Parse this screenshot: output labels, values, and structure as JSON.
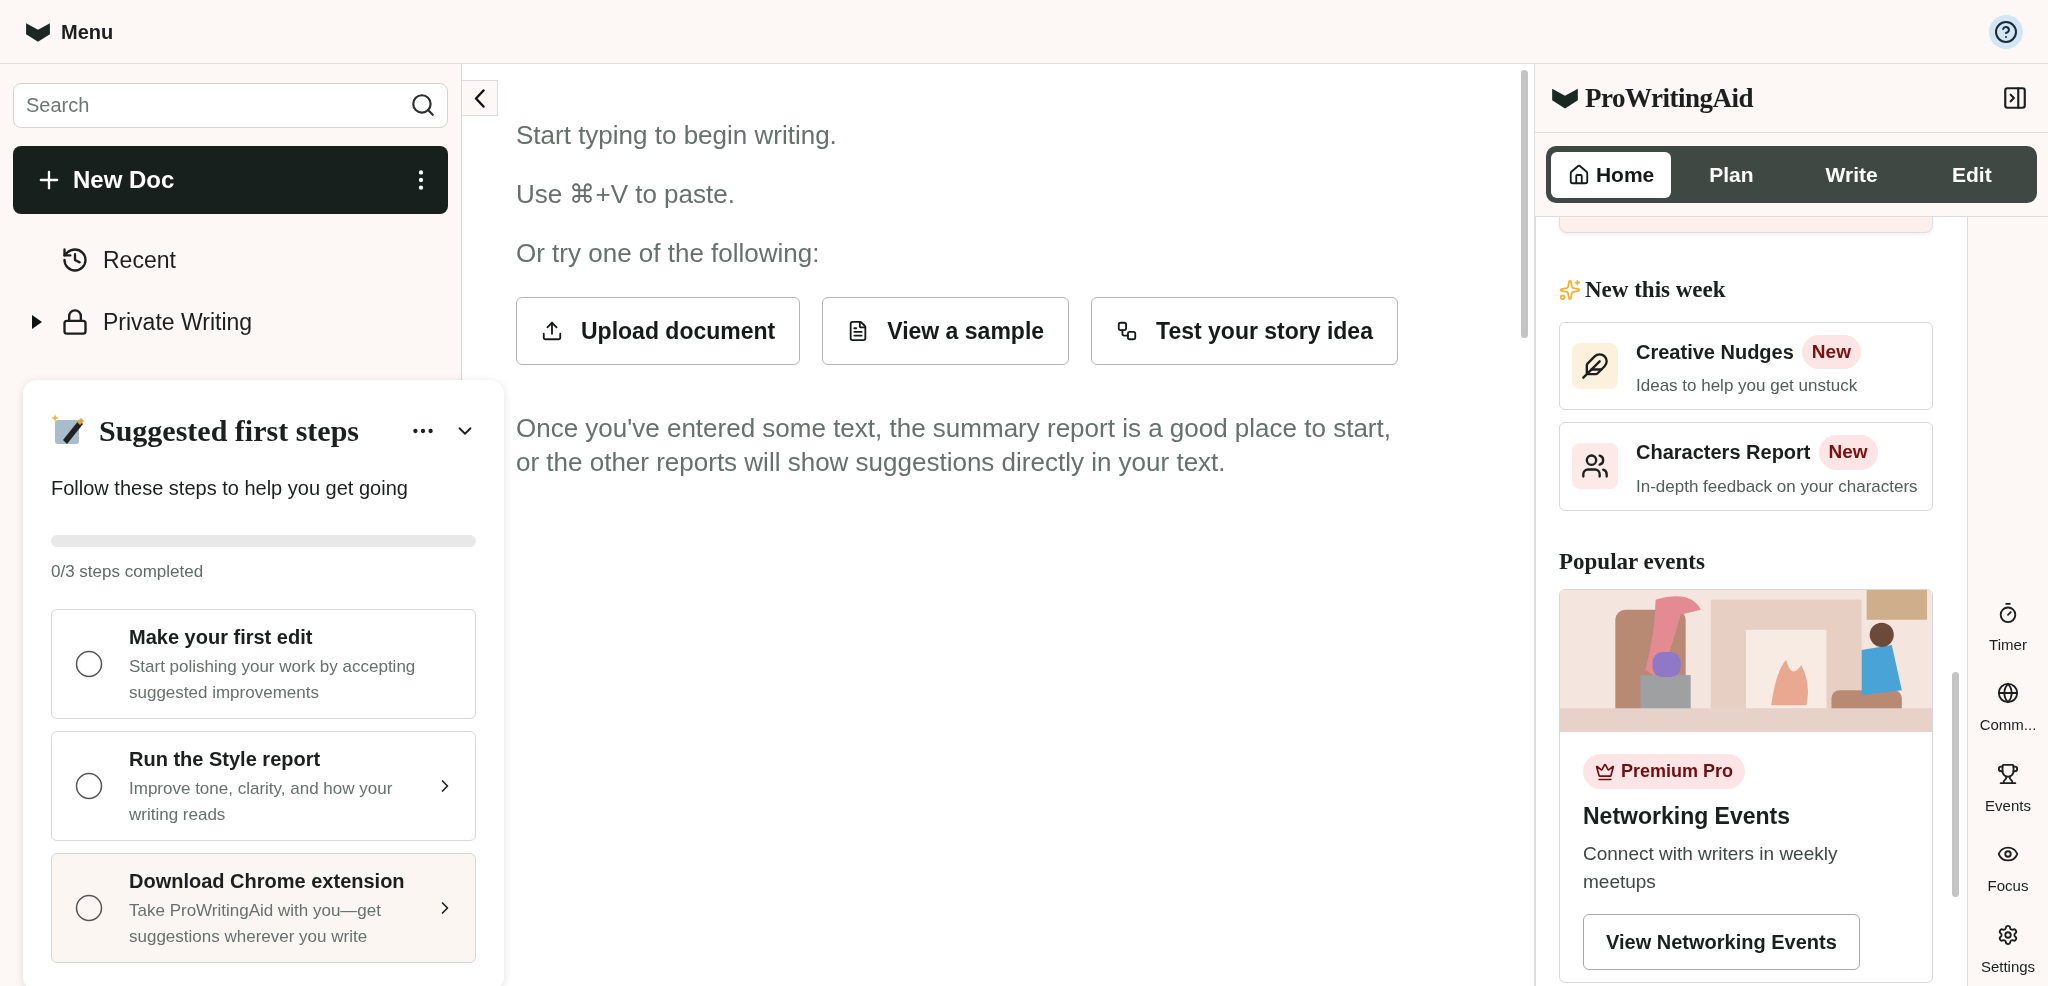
{
  "top_bar": {
    "menu_label": "Menu"
  },
  "sidebar": {
    "search": {
      "placeholder": "Search"
    },
    "new_doc": "New Doc",
    "nav": [
      {
        "label": "Recent",
        "kind": "recent"
      },
      {
        "label": "Private Writing",
        "kind": "folder",
        "expanded": false
      }
    ]
  },
  "first_steps": {
    "title": "Suggested first steps",
    "subtitle": "Follow these steps to help you get going",
    "progress": {
      "level": 0
    },
    "progress_label": "0/3 steps completed",
    "steps": [
      {
        "title": "Make your first edit",
        "description": "Start polishing your work by accepting suggested improvements",
        "checked": false,
        "chevron": false,
        "highlighted": false
      },
      {
        "title": "Run the Style report",
        "description": "Improve tone, clarity, and how your writing reads",
        "checked": false,
        "chevron": true,
        "highlighted": false
      },
      {
        "title": "Download Chrome extension",
        "description": "Take ProWritingAid with you—get suggestions wherever you write",
        "checked": false,
        "chevron": true,
        "highlighted": true
      }
    ]
  },
  "editor": {
    "lines": [
      "Start typing to begin writing.",
      "Use ⌘+V to paste.",
      "Or try one of the following:"
    ],
    "actions": [
      {
        "label": "Upload document"
      },
      {
        "label": "View a sample"
      },
      {
        "label": "Test your story idea"
      }
    ],
    "hint": "Once you've entered some text, the summary report is a good place to start, or the other reports will show suggestions directly in your text."
  },
  "assistant": {
    "brand": "ProWritingAid",
    "tabs": [
      {
        "label": "Home",
        "selected": true
      },
      {
        "label": "Plan",
        "selected": false
      },
      {
        "label": "Write",
        "selected": false
      },
      {
        "label": "Edit",
        "selected": false
      }
    ],
    "new_this_week": {
      "title": "New this week",
      "items": [
        {
          "title": "Creative Nudges",
          "badge": "New",
          "description": "Ideas to help you get unstuck"
        },
        {
          "title": "Characters Report",
          "badge": "New",
          "description": "In-depth feedback on your characters"
        }
      ]
    },
    "popular_events": {
      "title": "Popular events",
      "items": [
        {
          "badge": "Premium Pro",
          "title": "Networking Events",
          "description": "Connect with writers in weekly meetups",
          "button": "View Networking Events"
        }
      ]
    }
  },
  "rail": [
    {
      "label": "Timer"
    },
    {
      "label": "Comm..."
    },
    {
      "label": "Events"
    },
    {
      "label": "Focus"
    },
    {
      "label": "Settings"
    }
  ]
}
